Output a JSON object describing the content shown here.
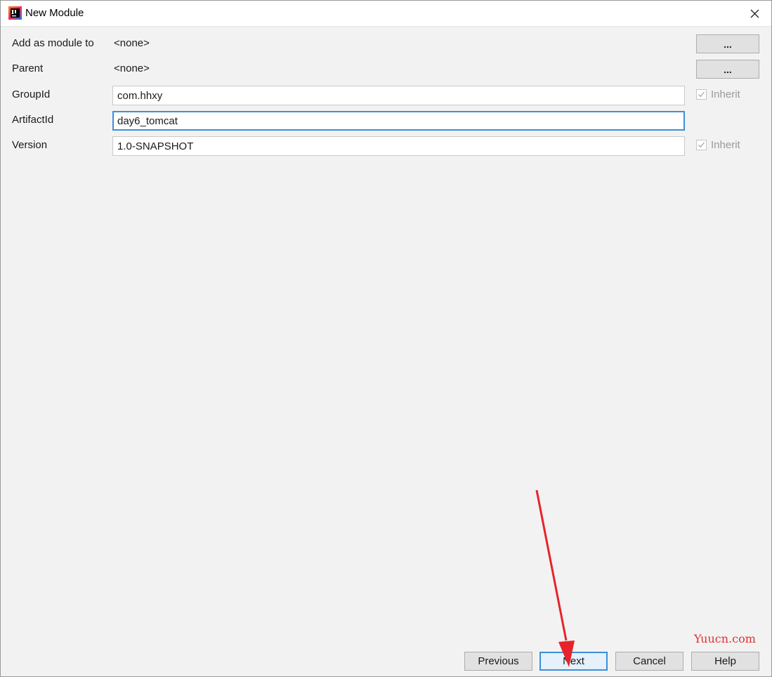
{
  "window": {
    "title": "New Module",
    "app_icon": "intellij-idea-icon",
    "close_icon": "close-icon"
  },
  "form": {
    "add_as_module_to": {
      "label": "Add as module to",
      "value": "<none>",
      "button": "..."
    },
    "parent": {
      "label": "Parent",
      "value": "<none>",
      "button": "..."
    },
    "group_id": {
      "label": "GroupId",
      "value": "com.hhxy",
      "inherit_label": "Inherit",
      "inherit_checked": true
    },
    "artifact_id": {
      "label": "ArtifactId",
      "value": "day6_tomcat"
    },
    "version": {
      "label": "Version",
      "value": "1.0-SNAPSHOT",
      "inherit_label": "Inherit",
      "inherit_checked": true
    }
  },
  "footer": {
    "previous": "Previous",
    "next": "Next",
    "cancel": "Cancel",
    "help": "Help"
  },
  "watermark": "Yuucn.com",
  "colors": {
    "focus": "#3c8fd9",
    "annotation_arrow": "#e8222b",
    "watermark": "#e03030"
  }
}
